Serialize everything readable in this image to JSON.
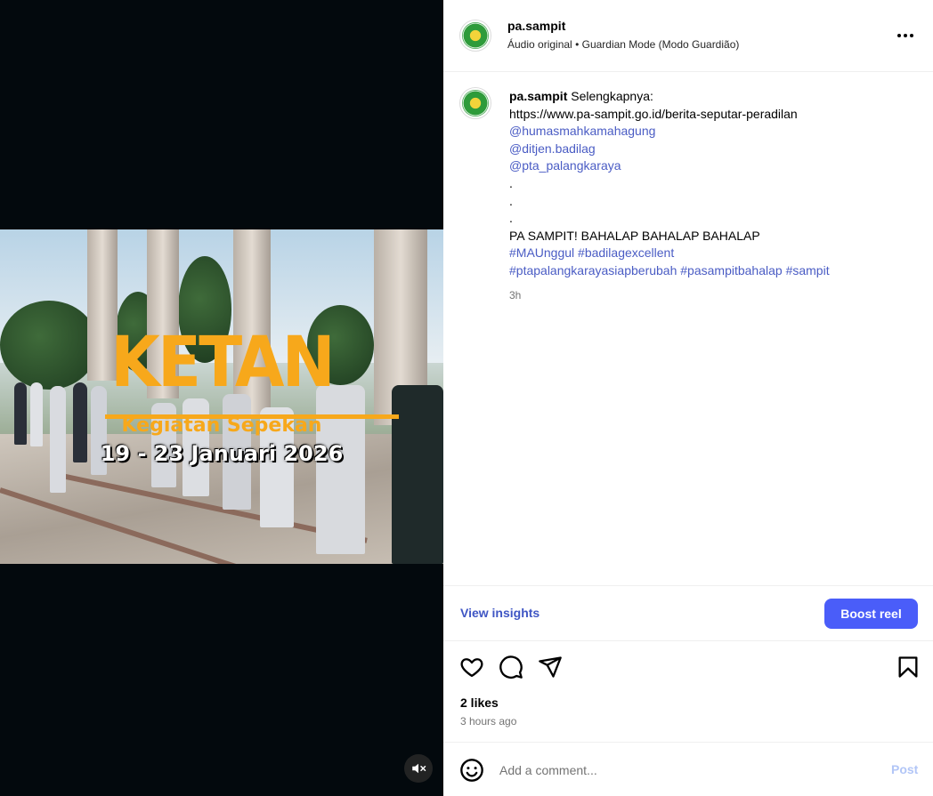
{
  "post": {
    "username": "pa.sampit",
    "audio": "Áudio original",
    "separator": "•",
    "mode": "Guardian Mode (Modo Guardião)",
    "more_icon": "more-horizontal-icon"
  },
  "video": {
    "title": "KETAN",
    "subtitle": "Kegiatan Sepekan",
    "dates": "19 - 23 Januari 2026",
    "mute_icon": "speaker-muted-icon",
    "colors": {
      "accent": "#f7a81b",
      "background": "#03090d"
    }
  },
  "caption": {
    "username": "pa.sampit",
    "lines": [
      "Selengkapnya:",
      "https://www.pa-sampit.go.id/berita-seputar-peradilan",
      "@humasmahkamahagung",
      "@ditjen.badilag",
      "@pta_palangkaraya",
      ".",
      ".",
      ".",
      "PA SAMPIT! BAHALAP BAHALAP BAHALAP",
      "#MAUnggul #badilagexcellent",
      "#ptapalangkarayasiapberubah #pasampitbahalap #sampit"
    ],
    "time": "3h"
  },
  "insights": {
    "view_label": "View insights",
    "boost_label": "Boost reel",
    "boost_color": "#4a5df9"
  },
  "actions": {
    "like_icon": "heart-icon",
    "comment_icon": "comment-icon",
    "share_icon": "send-icon",
    "save_icon": "bookmark-icon"
  },
  "stats": {
    "likes": "2 likes",
    "time_ago": "3 hours ago"
  },
  "comment": {
    "placeholder": "Add a comment...",
    "post_label": "Post",
    "emoji_icon": "emoji-icon"
  }
}
